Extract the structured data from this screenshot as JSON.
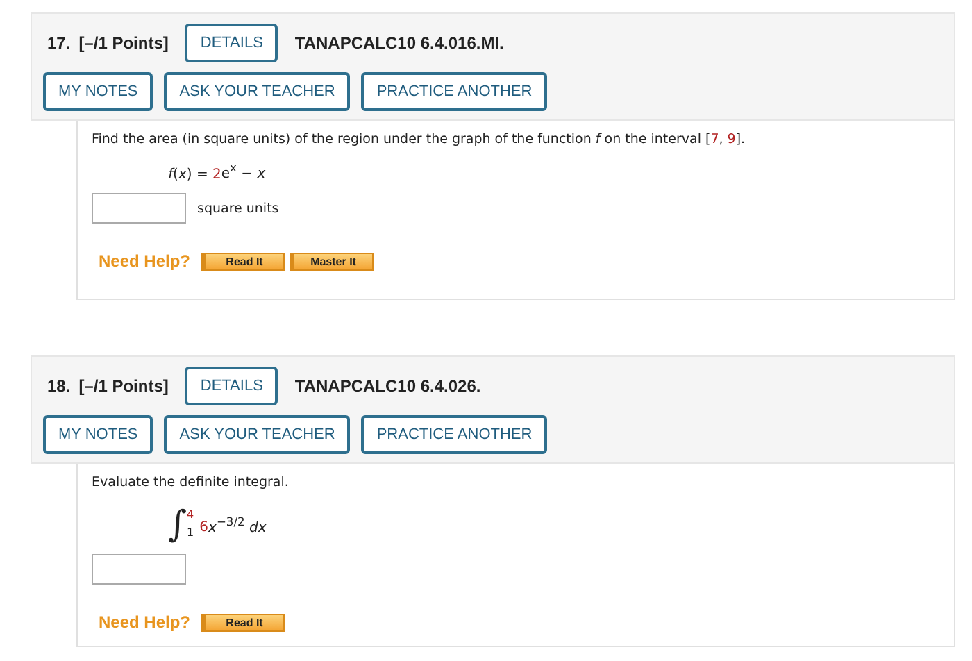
{
  "questions": [
    {
      "number": "17.",
      "points": "[–/1 Points]",
      "details_button": "DETAILS",
      "code": "TANAPCALC10 6.4.016.MI.",
      "actions": [
        "MY NOTES",
        "ASK YOUR TEACHER",
        "PRACTICE ANOTHER"
      ],
      "prompt": [
        {
          "text": "Find the area (in square units) of the region under the graph of the function *f* on the interval [",
          "highlight": false
        },
        {
          "text": "7",
          "highlight": true
        },
        {
          "text": ", ",
          "highlight": false
        },
        {
          "text": "9",
          "highlight": true
        },
        {
          "text": "].",
          "highlight": false
        }
      ],
      "formula": {
        "kind": "function",
        "parts": [
          {
            "text": "*f*(*x*) = ",
            "highlight": false
          },
          {
            "text": "2",
            "highlight": true
          },
          {
            "text": "e$^{x}$ − *x*",
            "highlight": false
          }
        ]
      },
      "answer": {
        "kind": "number",
        "unit": "square units"
      },
      "help": {
        "label": "Need Help?",
        "buttons": [
          "Read It",
          "Master It"
        ]
      }
    },
    {
      "number": "18.",
      "points": "[–/1 Points]",
      "details_button": "DETAILS",
      "code": "TANAPCALC10 6.4.026.",
      "actions": [
        "MY NOTES",
        "ASK YOUR TEACHER",
        "PRACTICE ANOTHER"
      ],
      "prompt": [
        {
          "text": "Evaluate the definite integral.",
          "highlight": false
        }
      ],
      "formula": {
        "kind": "integral",
        "sign": "∫",
        "lower": "1",
        "upper": "4",
        "upper_highlight": true,
        "parts": [
          {
            "text": "6",
            "highlight": true
          },
          {
            "text": "*x*$^{−3/2}$ *dx*",
            "highlight": false
          }
        ]
      },
      "answer": {
        "kind": "number"
      },
      "help": {
        "label": "Need Help?",
        "buttons": [
          "Read It"
        ]
      }
    }
  ]
}
